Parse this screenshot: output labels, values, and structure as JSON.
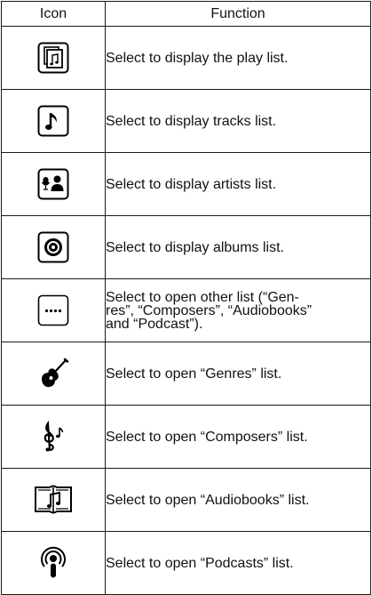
{
  "header": {
    "icon": "Icon",
    "function": "Function"
  },
  "rows": [
    {
      "icon": "playlist-icon",
      "lines": [
        "Select to display the play list."
      ]
    },
    {
      "icon": "music-note-icon",
      "lines": [
        "Select to display tracks list."
      ]
    },
    {
      "icon": "artist-icon",
      "lines": [
        "Select to display artists list."
      ]
    },
    {
      "icon": "album-disc-icon",
      "lines": [
        "Select to display albums list."
      ]
    },
    {
      "icon": "more-dots-icon",
      "lines": [
        "Select to open other list (“Gen-",
        "res”, “Composers”, “Audiobooks”",
        "and “Podcast”)."
      ]
    },
    {
      "icon": "guitar-icon",
      "lines": [
        "Select to open “Genres” list."
      ]
    },
    {
      "icon": "composer-clef-icon",
      "lines": [
        "Select to open “Composers” list."
      ]
    },
    {
      "icon": "audiobook-icon",
      "lines": [
        "Select to open “Audiobooks” list."
      ]
    },
    {
      "icon": "podcast-icon",
      "lines": [
        "Select to open “Podcasts” list."
      ]
    }
  ]
}
